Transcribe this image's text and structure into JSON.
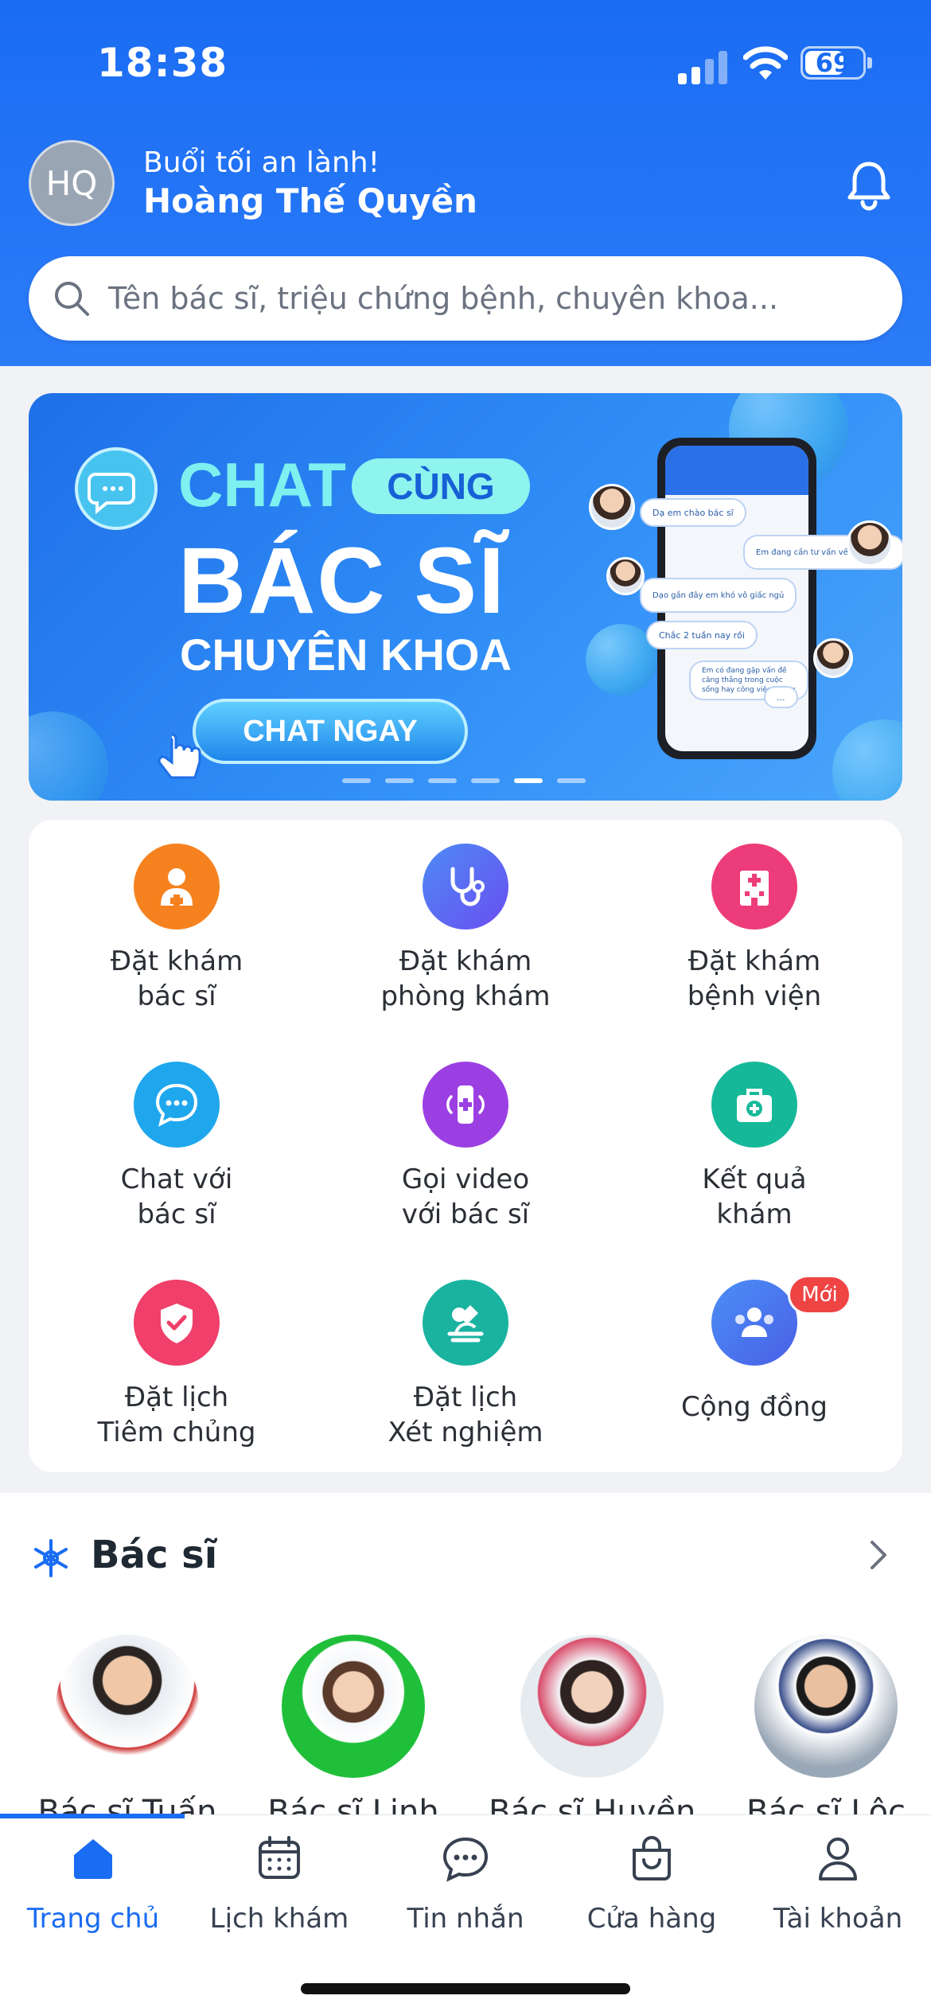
{
  "status_bar": {
    "time": "18:38",
    "battery": "69",
    "battery_level": 0.69
  },
  "header": {
    "avatar_initials": "HQ",
    "greeting": "Buổi tối an lành!",
    "user_name": "Hoàng Thế Quyền"
  },
  "search": {
    "placeholder": "Tên bác sĩ, triệu chứng bệnh, chuyên khoa..."
  },
  "banner": {
    "line1": "CHAT",
    "line1_badge": "CÙNG",
    "line2": "BÁC SĨ",
    "line3": "CHUYÊN KHOA",
    "cta": "CHAT NGAY",
    "chat_messages": [
      "Dạ em chào bác sĩ",
      "Em đang cần tư vấn về vấn đề gì?",
      "Dạo gần đây em khó vô giấc ngủ",
      "Chắc 2 tuần nay rồi",
      "Em có đang gặp vấn đề căng thẳng trong cuộc sống hay công việc không",
      "..."
    ],
    "slide_count": 6,
    "active_slide": 5
  },
  "services": [
    {
      "label": "Đặt khám\nbác sĩ",
      "icon": "doctor-icon",
      "color": "#f5821f"
    },
    {
      "label": "Đặt khám\nphòng khám",
      "icon": "stethoscope-icon",
      "color": "#5b63f0"
    },
    {
      "label": "Đặt khám\nbệnh viện",
      "icon": "hospital-icon",
      "color": "#ec3d7a"
    },
    {
      "label": "Chat với\nbác sĩ",
      "icon": "chat-icon",
      "color": "#1fa7ee"
    },
    {
      "label": "Gọi video\nvới bác sĩ",
      "icon": "video-call-icon",
      "color": "#9b3fe3"
    },
    {
      "label": "Kết quả\nkhám",
      "icon": "medical-kit-icon",
      "color": "#16b89a"
    },
    {
      "label": "Đặt lịch\nTiêm chủng",
      "icon": "shield-check-icon",
      "color": "#ef3f6a"
    },
    {
      "label": "Đặt lịch\nXét nghiệm",
      "icon": "microscope-icon",
      "color": "#19b3a0"
    },
    {
      "label": "Cộng đồng",
      "icon": "community-icon",
      "color": "#3c7bf0",
      "badge": "Mới"
    }
  ],
  "doctors_section": {
    "title": "Bác sĩ",
    "doctors": [
      {
        "name": "Bác sĩ Tuấn"
      },
      {
        "name": "Bác sĩ Linh"
      },
      {
        "name": "Bác sĩ Huyền"
      },
      {
        "name": "Bác sĩ Lộc"
      }
    ]
  },
  "tabbar": {
    "tabs": [
      {
        "label": "Trang chủ",
        "icon": "home-icon",
        "active": true
      },
      {
        "label": "Lịch khám",
        "icon": "calendar-icon"
      },
      {
        "label": "Tin nhắn",
        "icon": "message-icon"
      },
      {
        "label": "Cửa hàng",
        "icon": "shopping-bag-icon"
      },
      {
        "label": "Tài khoản",
        "icon": "user-icon"
      }
    ]
  },
  "colors": {
    "primary": "#1a6cf2",
    "badge": "#ef4444"
  }
}
